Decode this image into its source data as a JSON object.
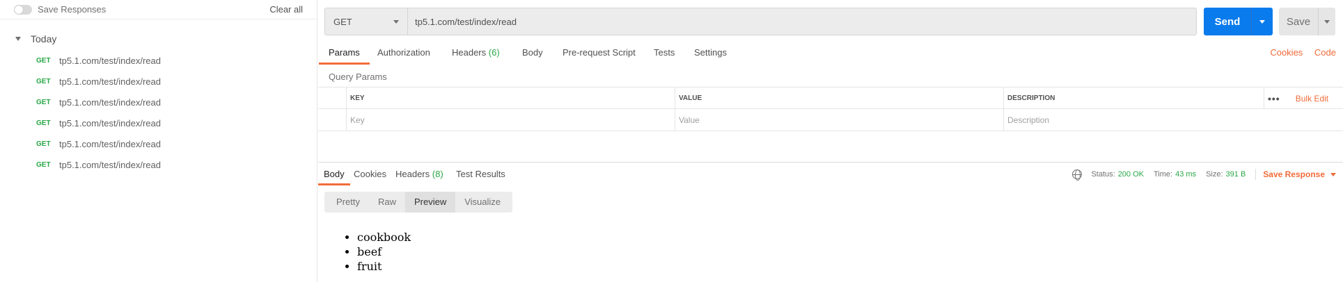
{
  "sidebar": {
    "save_responses_label": "Save Responses",
    "clear_all_label": "Clear all",
    "group_label": "Today",
    "history": [
      {
        "method": "GET",
        "url": "tp5.1.com/test/index/read"
      },
      {
        "method": "GET",
        "url": "tp5.1.com/test/index/read"
      },
      {
        "method": "GET",
        "url": "tp5.1.com/test/index/read"
      },
      {
        "method": "GET",
        "url": "tp5.1.com/test/index/read"
      },
      {
        "method": "GET",
        "url": "tp5.1.com/test/index/read"
      },
      {
        "method": "GET",
        "url": "tp5.1.com/test/index/read"
      }
    ]
  },
  "request": {
    "method": "GET",
    "url": "tp5.1.com/test/index/read",
    "send_label": "Send",
    "save_label": "Save",
    "tabs": {
      "params": "Params",
      "authorization": "Authorization",
      "headers": "Headers",
      "headers_count": "(6)",
      "body": "Body",
      "prerequest": "Pre-request Script",
      "tests": "Tests",
      "settings": "Settings"
    },
    "cookies_link": "Cookies",
    "code_link": "Code",
    "query_params_title": "Query Params",
    "table": {
      "key_header": "KEY",
      "value_header": "VALUE",
      "description_header": "DESCRIPTION",
      "more": "•••",
      "bulk_edit": "Bulk Edit",
      "key_placeholder": "Key",
      "value_placeholder": "Value",
      "description_placeholder": "Description"
    }
  },
  "response": {
    "tabs": {
      "body": "Body",
      "cookies": "Cookies",
      "headers": "Headers",
      "headers_count": "(8)",
      "test_results": "Test Results"
    },
    "status_label": "Status:",
    "status_value": "200 OK",
    "time_label": "Time:",
    "time_value": "43 ms",
    "size_label": "Size:",
    "size_value": "391 B",
    "save_response_label": "Save Response",
    "view_tabs": [
      "Pretty",
      "Raw",
      "Preview",
      "Visualize"
    ],
    "active_view": "Preview",
    "preview_items": [
      "cookbook",
      "beef",
      "fruit"
    ]
  },
  "colors": {
    "accent": "#f26b3a",
    "send_blue": "#097bed",
    "success_green": "#28a745"
  }
}
